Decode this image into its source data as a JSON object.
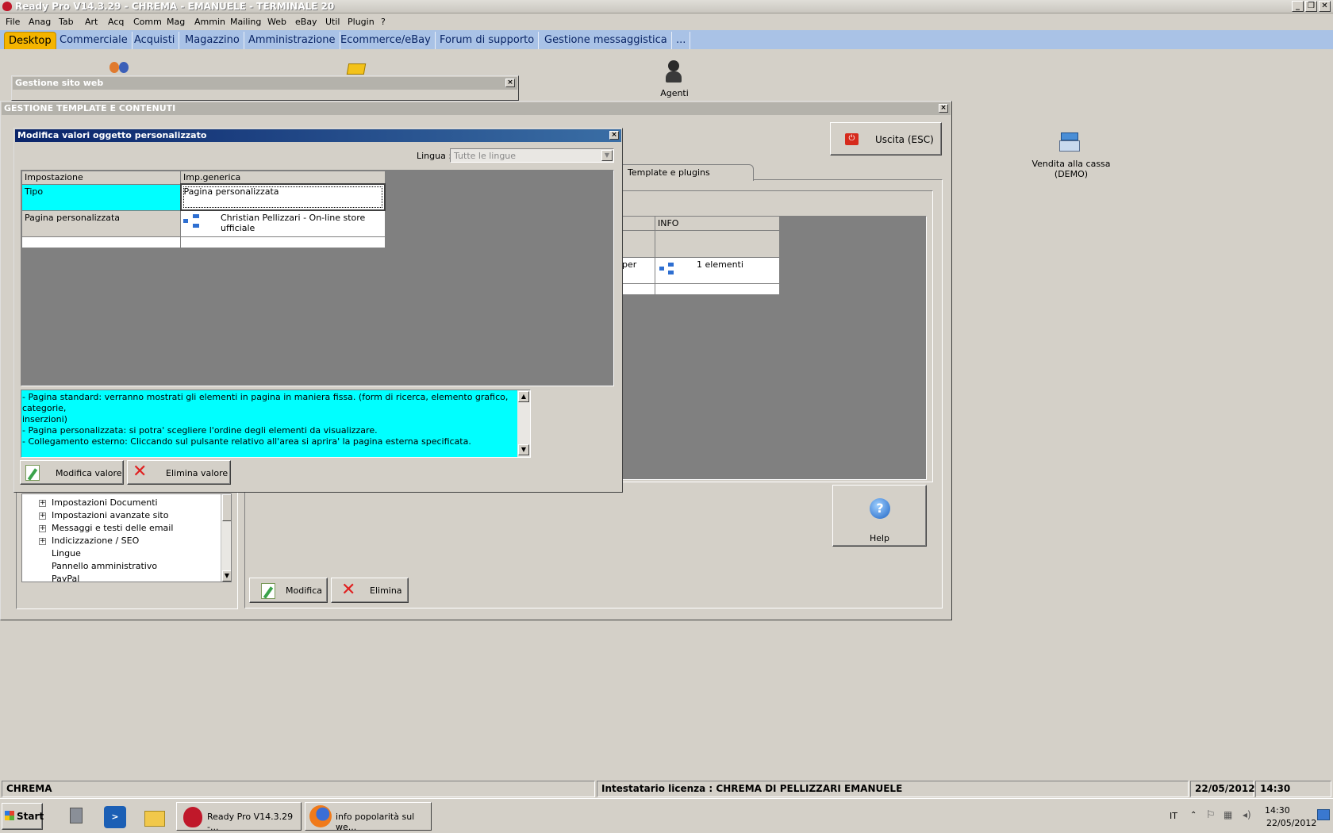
{
  "app": {
    "title": "Ready Pro V14.3.29 - CHREMA - EMANUELE - TERMINALE 20"
  },
  "menu": [
    "File",
    "Anag",
    "Tab",
    "Art",
    "Acq",
    "Comm",
    "Mag",
    "Ammin",
    "Mailing",
    "Web",
    "eBay",
    "Util",
    "Plugin",
    "?"
  ],
  "modules": [
    "Desktop",
    "Commerciale",
    "Acquisti",
    "Magazzino",
    "Amministrazione",
    "Ecommerce/eBay",
    "Forum di supporto",
    "Gestione messaggistica",
    "..."
  ],
  "desktop": {
    "agenti": "Agenti",
    "vendita_line1": "Vendita alla cassa",
    "vendita_line2": "(DEMO)"
  },
  "gestione_sito": {
    "title": "Gestione sito web"
  },
  "gestione_template": {
    "title": "GESTIONE TEMPLATE E CONTENUTI",
    "uscita": "Uscita (ESC)",
    "tab_template_plugins": "Template e plugins",
    "grid": {
      "col_info": "INFO",
      "row_partial": "per",
      "row_info": "1 elementi"
    },
    "tree": [
      "Impostazioni Documenti",
      "Impostazioni avanzate sito",
      "Messaggi e testi delle email",
      "Indicizzazione / SEO",
      "Lingue",
      "Pannello amministrativo",
      "PayPal"
    ],
    "help": "Help",
    "modifica": "Modifica",
    "elimina": "Elimina"
  },
  "dialog": {
    "title": "Modifica valori oggetto personalizzato",
    "lingua_label": "Lingua :",
    "lingua_value": "Tutte le lingue",
    "columns": [
      "Impostazione",
      "Imp.generica"
    ],
    "rows": [
      {
        "key": "Tipo",
        "value": "Pagina personalizzata"
      },
      {
        "key": "Pagina personalizzata",
        "value": "Christian Pellizzari - On-line store ufficiale"
      }
    ],
    "info_lines": [
      "- Pagina standard: verranno mostrati gli elementi in pagina in maniera fissa. (form di ricerca, elemento grafico, categorie,",
      "inserzioni)",
      "- Pagina personalizzata: si potra' scegliere l'ordine degli elementi da visualizzare.",
      "- Collegamento esterno: Cliccando sul pulsante relativo all'area si aprira' la pagina esterna specificata."
    ],
    "modifica_valore": "Modifica valore",
    "elimina_valore": "Elimina valore"
  },
  "statusbar": {
    "company": "CHREMA",
    "license": "Intestatario licenza : CHREMA DI PELLIZZARI EMANUELE",
    "date": "22/05/2012",
    "time": "14:30"
  },
  "taskbar": {
    "start": "Start",
    "task1": "Ready Pro V14.3.29 -...",
    "task2": "info popolarità sul we...",
    "lang": "IT",
    "clock_time": "14:30",
    "clock_date": "22/05/2012"
  },
  "colors": {
    "cyan": "#00ffff",
    "tab_blue": "#a9c2e6",
    "active_tab": "#f4b400",
    "dialog_title": "#0a246a"
  }
}
